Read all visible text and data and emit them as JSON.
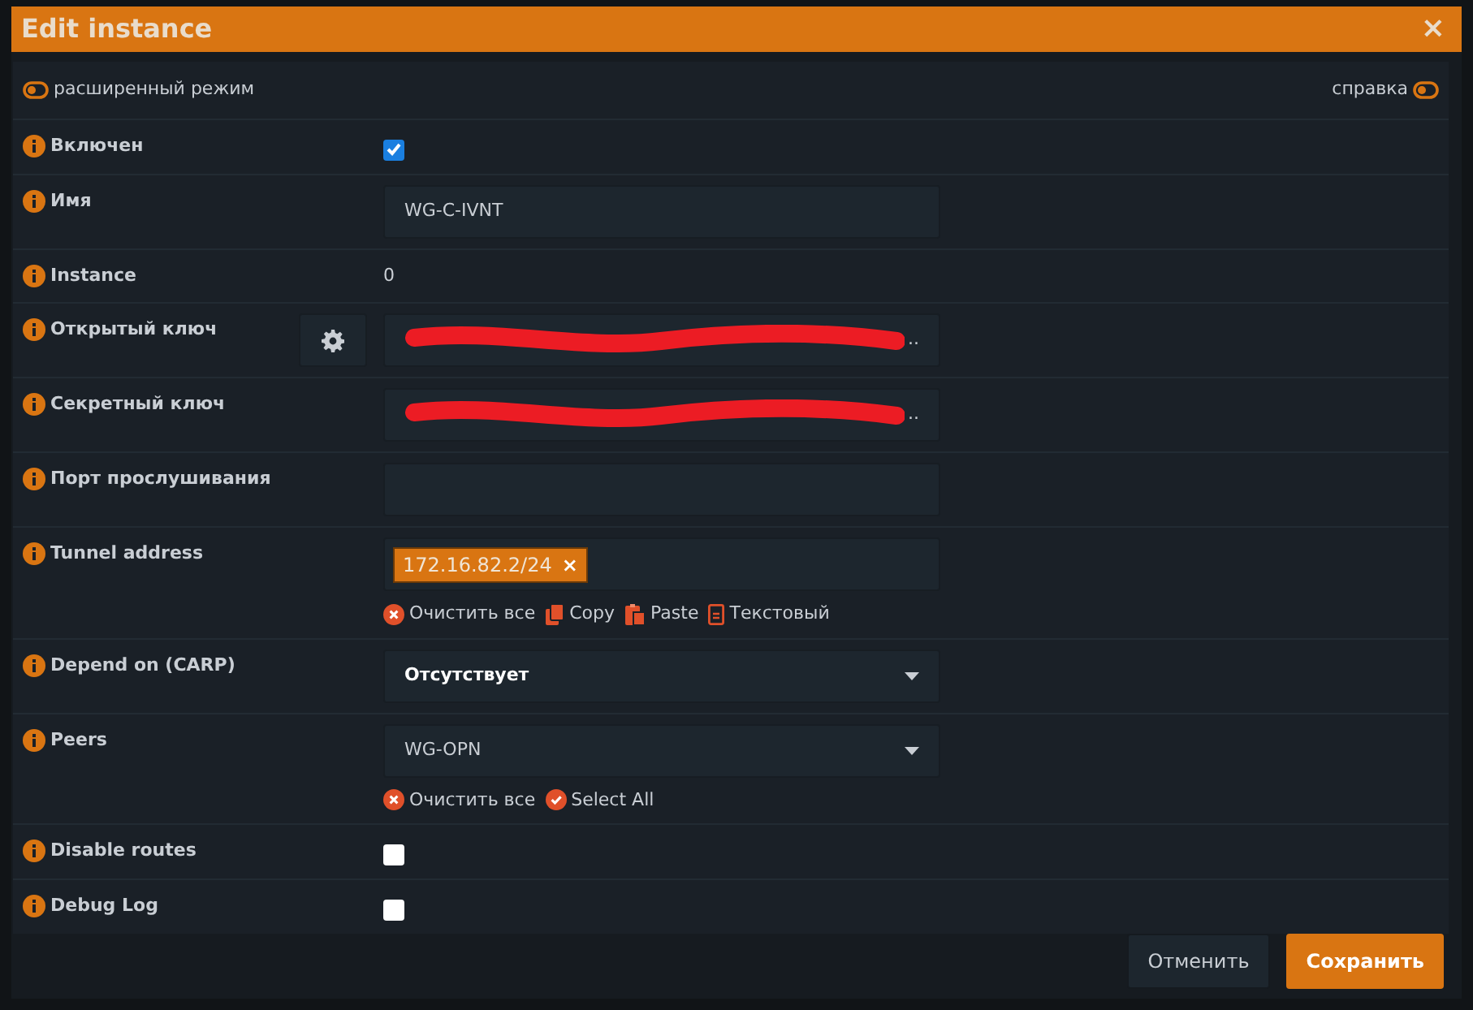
{
  "dialog": {
    "title": "Edit instance",
    "close": "×"
  },
  "toggles": [
    {
      "label": "расширенный режим",
      "on": false
    },
    {
      "label": "справка",
      "on": false
    }
  ],
  "fields": [
    {
      "kind": "checkbox",
      "label": "Включен",
      "checked": true
    },
    {
      "kind": "text",
      "label": "Имя",
      "value": "WG-C-IVNT"
    },
    {
      "kind": "static",
      "label": "Instance",
      "value": "0"
    },
    {
      "kind": "redacted",
      "label": "Открытый ключ",
      "tail": "..",
      "gear": true
    },
    {
      "kind": "redacted",
      "label": "Секретный ключ",
      "tail": "..",
      "gear": false
    },
    {
      "kind": "text",
      "label": "Порт прослушивания"
    },
    {
      "kind": "tags",
      "label": "Tunnel address",
      "tags": [
        {
          "text": "172.16.82.2/24",
          "remove": "×"
        }
      ],
      "actions": [
        {
          "kind": "clear",
          "label": "Очистить все"
        },
        {
          "kind": "copy",
          "label": "Copy"
        },
        {
          "kind": "paste",
          "label": "Paste"
        },
        {
          "kind": "text",
          "label": "Текстовый"
        }
      ]
    },
    {
      "kind": "select",
      "label": "Depend on (CARP)",
      "value": "Отсутствует",
      "emphasis": true
    },
    {
      "kind": "select",
      "label": "Peers",
      "value": "WG-OPN",
      "emphasis": false,
      "actions": [
        {
          "kind": "clear",
          "label": "Очистить все"
        },
        {
          "kind": "select-all",
          "label": "Select All"
        }
      ]
    },
    {
      "kind": "checkbox",
      "label": "Disable routes",
      "checked": false
    },
    {
      "kind": "checkbox",
      "label": "Debug Log",
      "checked": false
    }
  ],
  "buttons": [
    {
      "kind": "secondary",
      "label": "Отменить"
    },
    {
      "kind": "primary",
      "label": "Сохранить"
    }
  ]
}
